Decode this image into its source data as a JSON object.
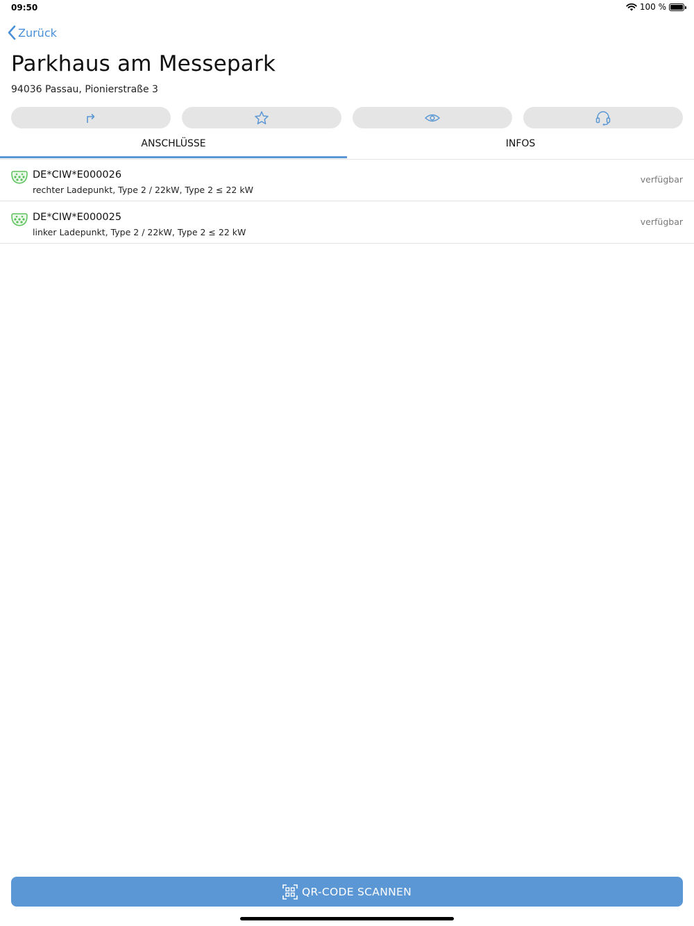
{
  "status_bar": {
    "time": "09:50",
    "battery_text": "100 %",
    "battery_level": 1.0,
    "icons": [
      "wifi-icon",
      "battery-icon"
    ]
  },
  "nav": {
    "back_label": "Zurück",
    "back_icon": "chevron-left-icon"
  },
  "location": {
    "title": "Parkhaus am Messepark",
    "address": "94036 Passau, Pionierstraße 3"
  },
  "actions": [
    {
      "icon": "route-arrow-icon"
    },
    {
      "icon": "star-icon"
    },
    {
      "icon": "eye-icon"
    },
    {
      "icon": "headset-icon"
    }
  ],
  "tabs": [
    {
      "label": "ANSCHLÜSSE",
      "active": true
    },
    {
      "label": "INFOS",
      "active": false
    }
  ],
  "connectors": [
    {
      "id": "DE*CIW*E000026",
      "description": "rechter Ladepunkt, Type 2 / 22kW, Type 2 ≤ 22 kW",
      "status": "verfügbar",
      "icon": "type2-plug-icon"
    },
    {
      "id": "DE*CIW*E000025",
      "description": "linker Ladepunkt, Type 2 / 22kW, Type 2 ≤ 22 kW",
      "status": "verfügbar",
      "icon": "type2-plug-icon"
    }
  ],
  "scan_button": {
    "label": "QR-CODE SCANNEN",
    "icon": "qr-code-icon"
  },
  "colors": {
    "accent": "#5b97d4",
    "link": "#4a90d9",
    "available": "#5cc25c",
    "button_bg": "#e5e5e5"
  }
}
